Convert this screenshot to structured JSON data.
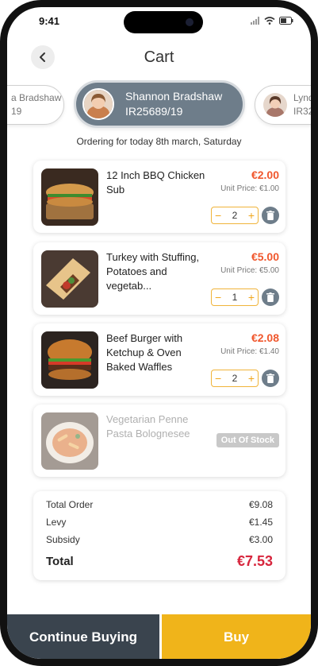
{
  "status_bar": {
    "time": "9:41"
  },
  "header": {
    "title": "Cart"
  },
  "people": [
    {
      "line1": "a Bradshaw",
      "line2": "19"
    },
    {
      "line1": "Shannon Bradshaw",
      "line2": "IR25689/19"
    },
    {
      "line1": "Lynd",
      "line2": "IR32"
    }
  ],
  "ordering_text": "Ordering for today 8th march, Saturday",
  "items": [
    {
      "name": "12 Inch BBQ Chicken Sub",
      "price": "€2.00",
      "unit_price": "Unit Price: €1.00",
      "qty": "2",
      "image": "sub-sandwich-image"
    },
    {
      "name": "Turkey with Stuffing, Potatoes and vegetab...",
      "price": "€5.00",
      "unit_price": "Unit Price: €5.00",
      "qty": "1",
      "image": "wrap-image"
    },
    {
      "name": "Beef Burger with Ketchup & Oven Baked Waffles",
      "price": "€2.08",
      "unit_price": "Unit Price: €1.40",
      "qty": "2",
      "image": "burger-image"
    },
    {
      "name": "Vegetarian Penne Pasta Bolognesee",
      "status": "Out Of Stock",
      "image": "pasta-image"
    }
  ],
  "summary": {
    "total_order_label": "Total Order",
    "total_order_value": "€9.08",
    "levy_label": "Levy",
    "levy_value": "€1.45",
    "subsidy_label": "Subsidy",
    "subsidy_value": "€3.00",
    "total_label": "Total",
    "total_value": "€7.53"
  },
  "buttons": {
    "continue": "Continue Buying",
    "buy": "Buy"
  },
  "colors": {
    "accent": "#f0b41a",
    "price": "#f0572d",
    "total": "#d7263d",
    "dark": "#3a444e",
    "slate": "#6e7d8a"
  }
}
